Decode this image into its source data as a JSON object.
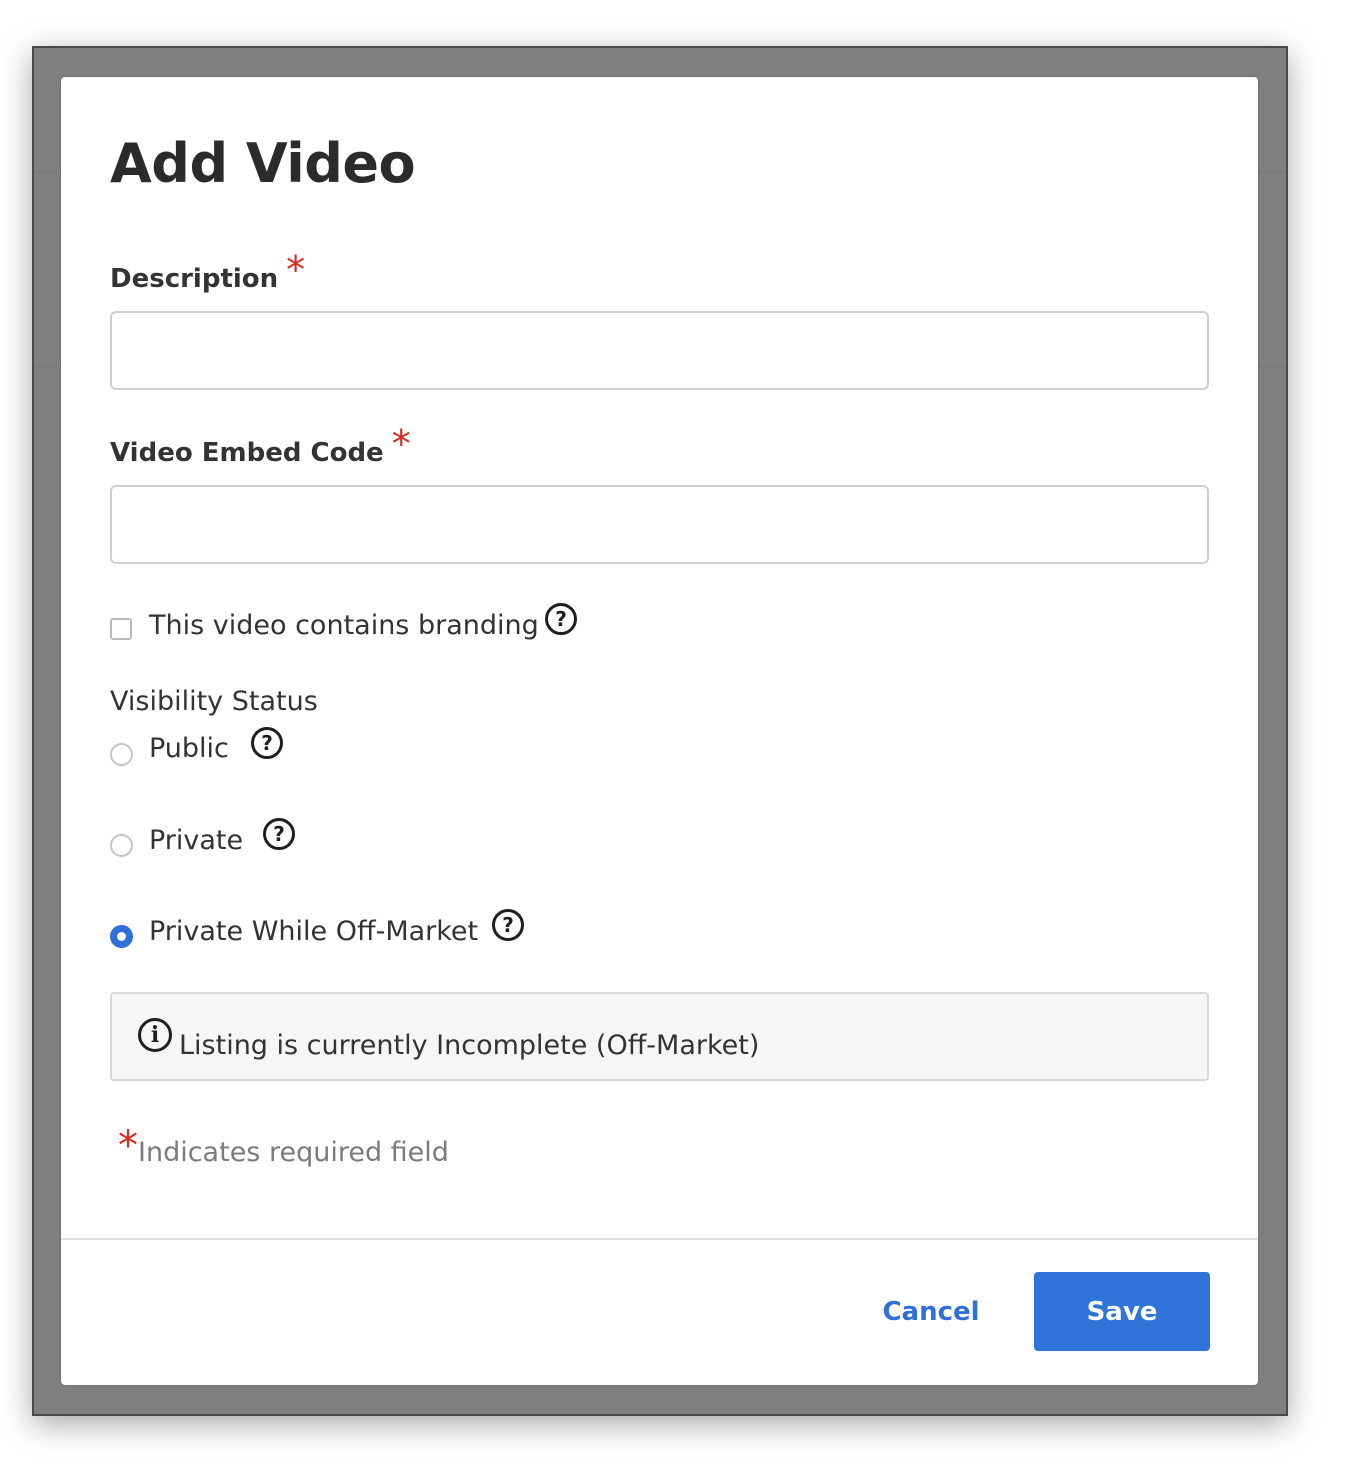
{
  "dialog": {
    "title": "Add Video",
    "fields": {
      "description_label": "Description",
      "description_value": "",
      "embed_label": "Video Embed Code",
      "embed_value": "",
      "required_mark": "*"
    },
    "branding": {
      "label": "This video contains branding",
      "checked": false
    },
    "visibility": {
      "label": "Visibility Status",
      "options": [
        {
          "label": "Public",
          "selected": false
        },
        {
          "label": "Private",
          "selected": false
        },
        {
          "label": "Private While Off-Market",
          "selected": true
        }
      ]
    },
    "info_box": {
      "icon": "info-icon",
      "text": "Listing is currently Incomplete (Off-Market)"
    },
    "required_note": "Indicates required field",
    "buttons": {
      "cancel": "Cancel",
      "save": "Save"
    }
  },
  "colors": {
    "accent": "#2f75d9",
    "required": "#d42a1e",
    "overlay": "#7f7f7f"
  }
}
